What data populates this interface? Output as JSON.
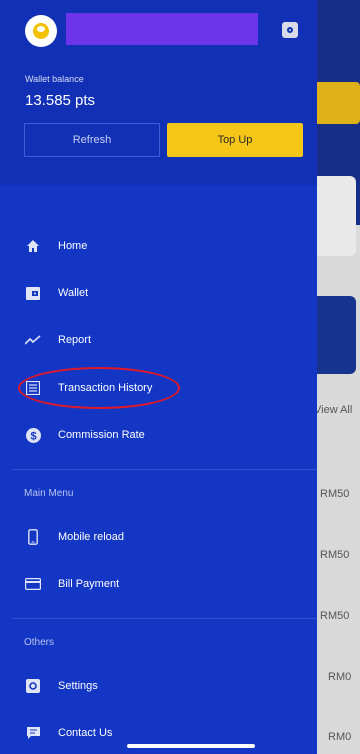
{
  "drawer": {
    "wallet_label": "Wallet balance",
    "wallet_value": "13.585 pts",
    "refresh_label": "Refresh",
    "topup_label": "Top Up"
  },
  "menu": {
    "home": "Home",
    "wallet": "Wallet",
    "report": "Report",
    "transaction_history": "Transaction History",
    "commission_rate": "Commission Rate"
  },
  "main_menu": {
    "title": "Main Menu",
    "mobile_reload": "Mobile reload",
    "bill_payment": "Bill Payment"
  },
  "others": {
    "title": "Others",
    "settings": "Settings",
    "contact_us": "Contact Us"
  },
  "background": {
    "view_all": "View All",
    "rows": [
      "RM50",
      "RM50",
      "RM50",
      "RM0",
      "RM0"
    ]
  },
  "icons": {
    "home": "home-icon",
    "wallet": "wallet-icon",
    "report": "report-icon",
    "transaction_history": "list-icon",
    "commission_rate": "dollar-icon",
    "mobile_reload": "phone-icon",
    "bill_payment": "card-icon",
    "settings": "gear-icon",
    "contact_us": "chat-icon"
  },
  "colors": {
    "drawer_bg": "#1336c4",
    "drawer_top": "#1130b5",
    "topup": "#f5c518",
    "highlight": "#e0182a"
  }
}
